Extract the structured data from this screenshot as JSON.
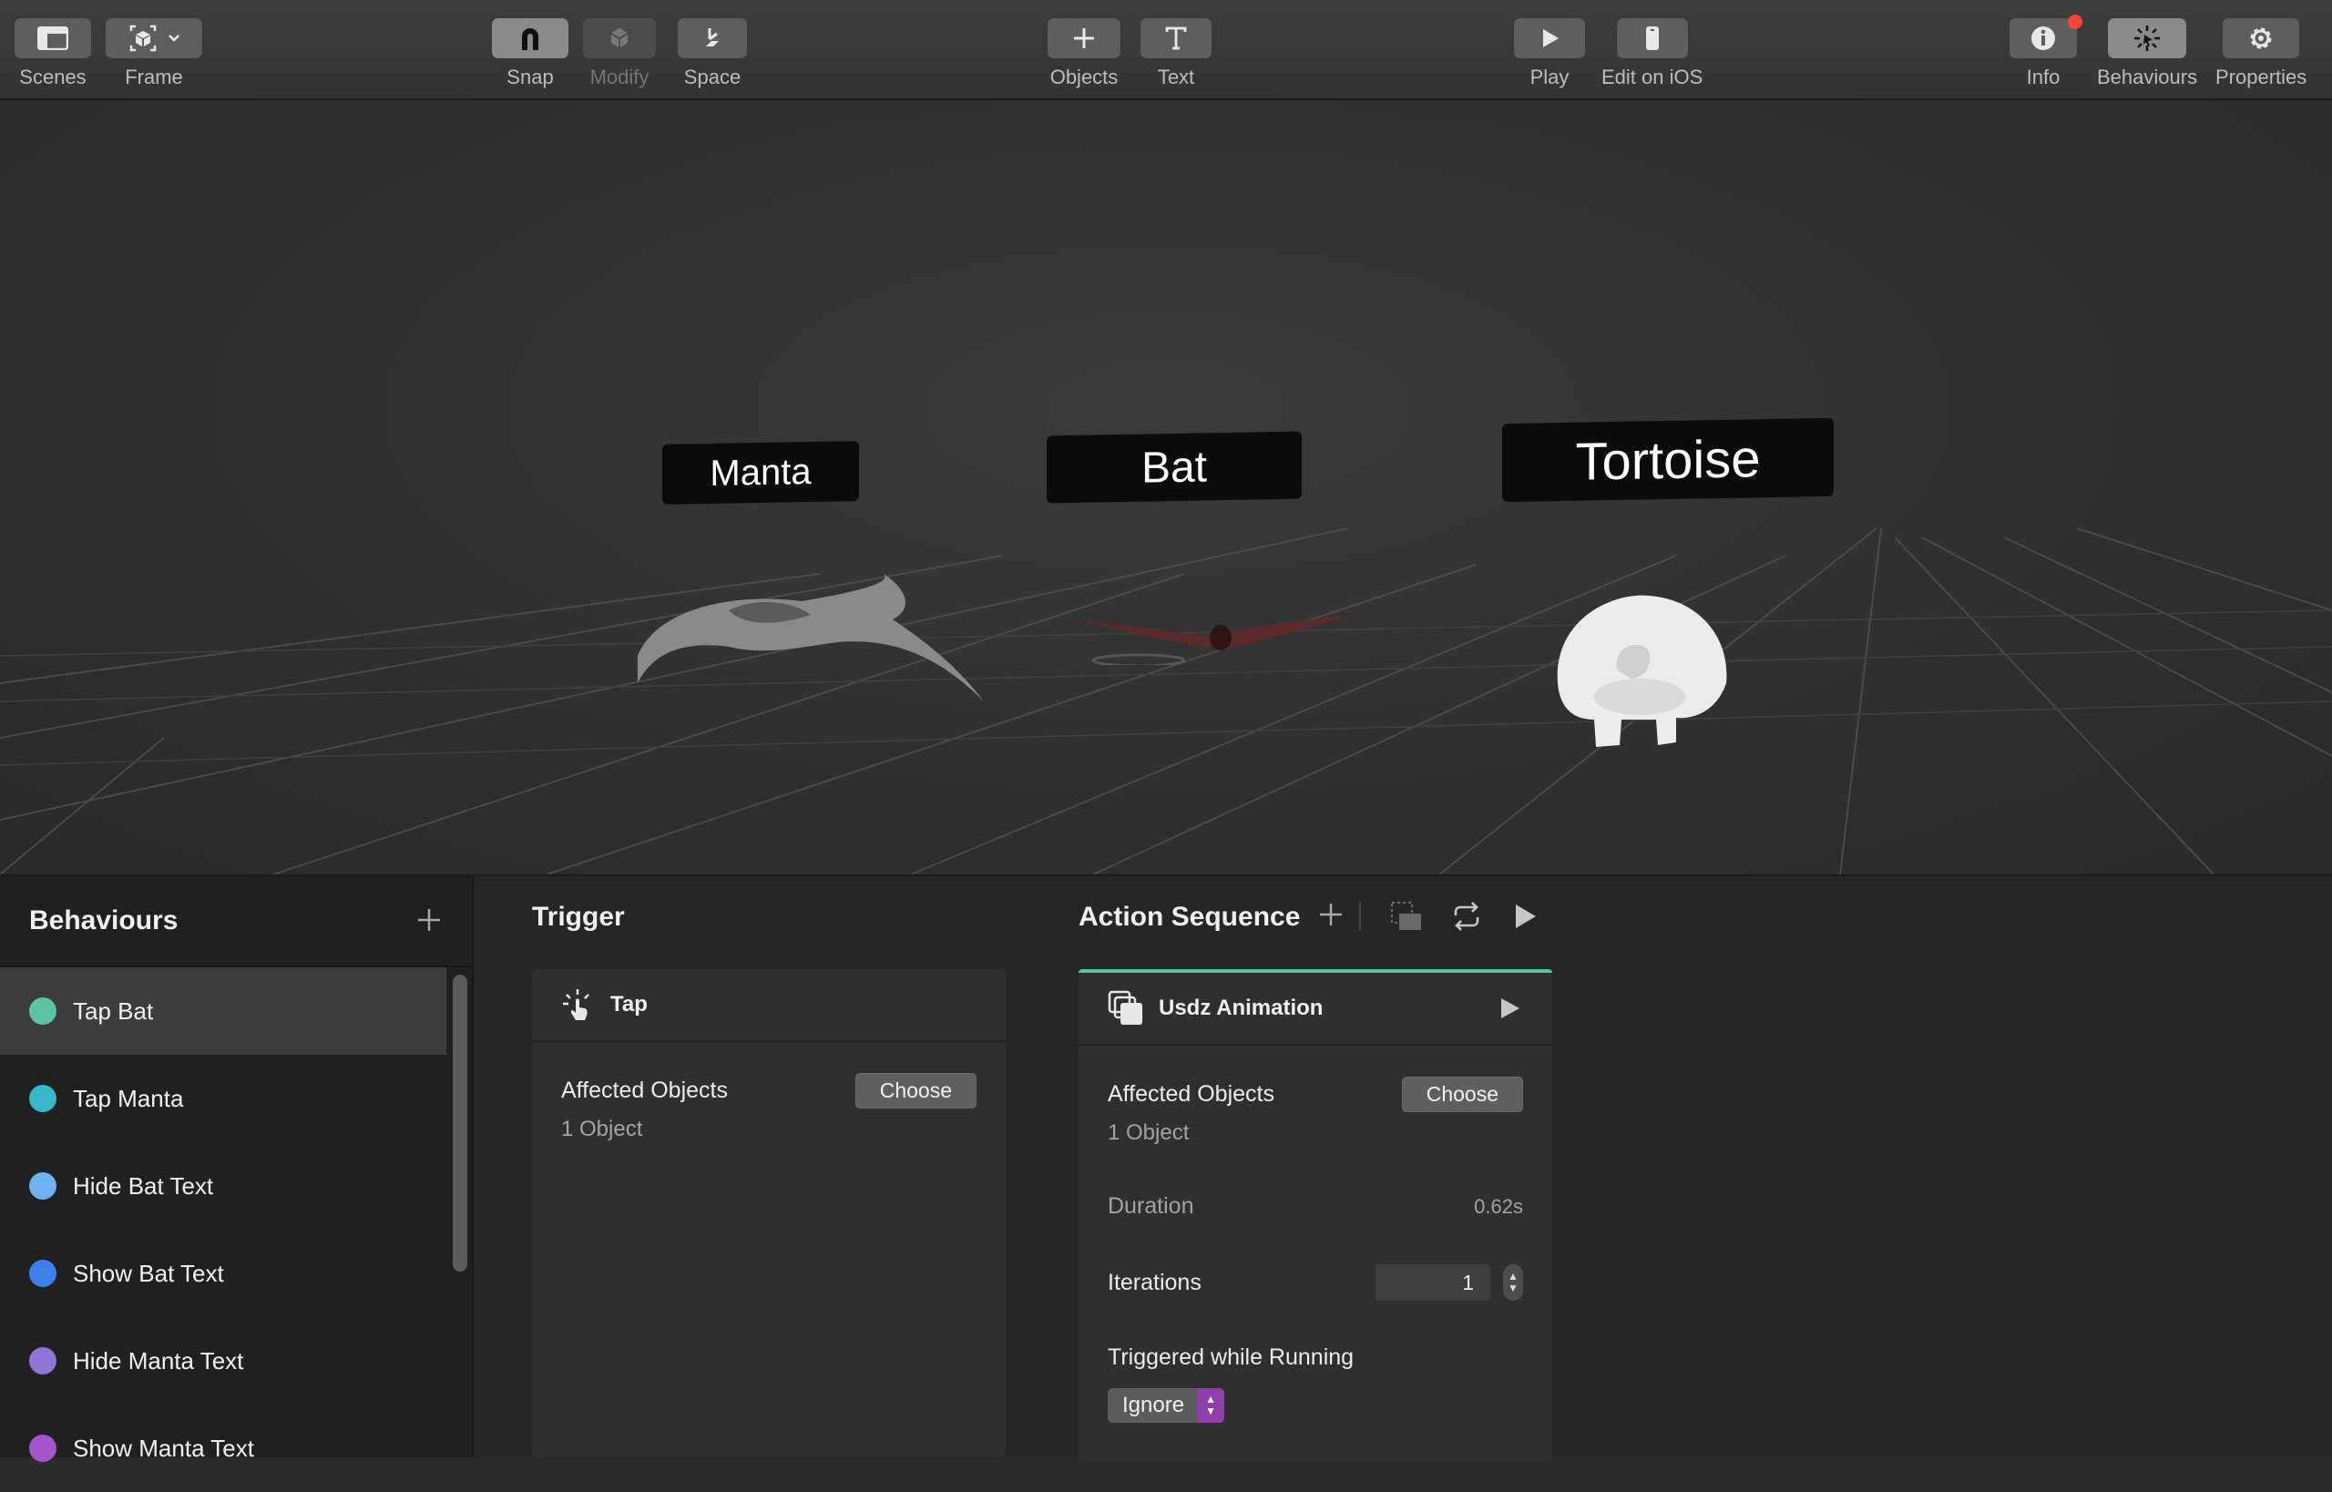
{
  "toolbar": {
    "scenes": "Scenes",
    "frame": "Frame",
    "snap": "Snap",
    "modify": "Modify",
    "space": "Space",
    "objects": "Objects",
    "text": "Text",
    "play": "Play",
    "edit_ios": "Edit on iOS",
    "info": "Info",
    "behaviours": "Behaviours",
    "properties": "Properties"
  },
  "scene": {
    "labels": [
      "Manta",
      "Bat",
      "Tortoise"
    ]
  },
  "sidebar": {
    "title": "Behaviours",
    "items": [
      {
        "label": "Tap Bat",
        "color": "#5cc3a6"
      },
      {
        "label": "Tap Manta",
        "color": "#36b8c9"
      },
      {
        "label": "Hide Bat Text",
        "color": "#6eb3f2"
      },
      {
        "label": "Show Bat Text",
        "color": "#3f7fea"
      },
      {
        "label": "Hide Manta Text",
        "color": "#8f74d8"
      },
      {
        "label": "Show Manta Text",
        "color": "#a455c8"
      }
    ]
  },
  "trigger": {
    "title": "Trigger",
    "card_title": "Tap",
    "affected_label": "Affected Objects",
    "affected_value": "1 Object",
    "choose": "Choose"
  },
  "action_sequence": {
    "title": "Action Sequence",
    "card_title": "Usdz Animation",
    "affected_label": "Affected Objects",
    "affected_value": "1 Object",
    "choose": "Choose",
    "duration_label": "Duration",
    "duration_value": "0.62s",
    "iterations_label": "Iterations",
    "iterations_value": "1",
    "triggered_label": "Triggered while Running",
    "triggered_value": "Ignore",
    "accent_color": "#4fc7a7"
  }
}
